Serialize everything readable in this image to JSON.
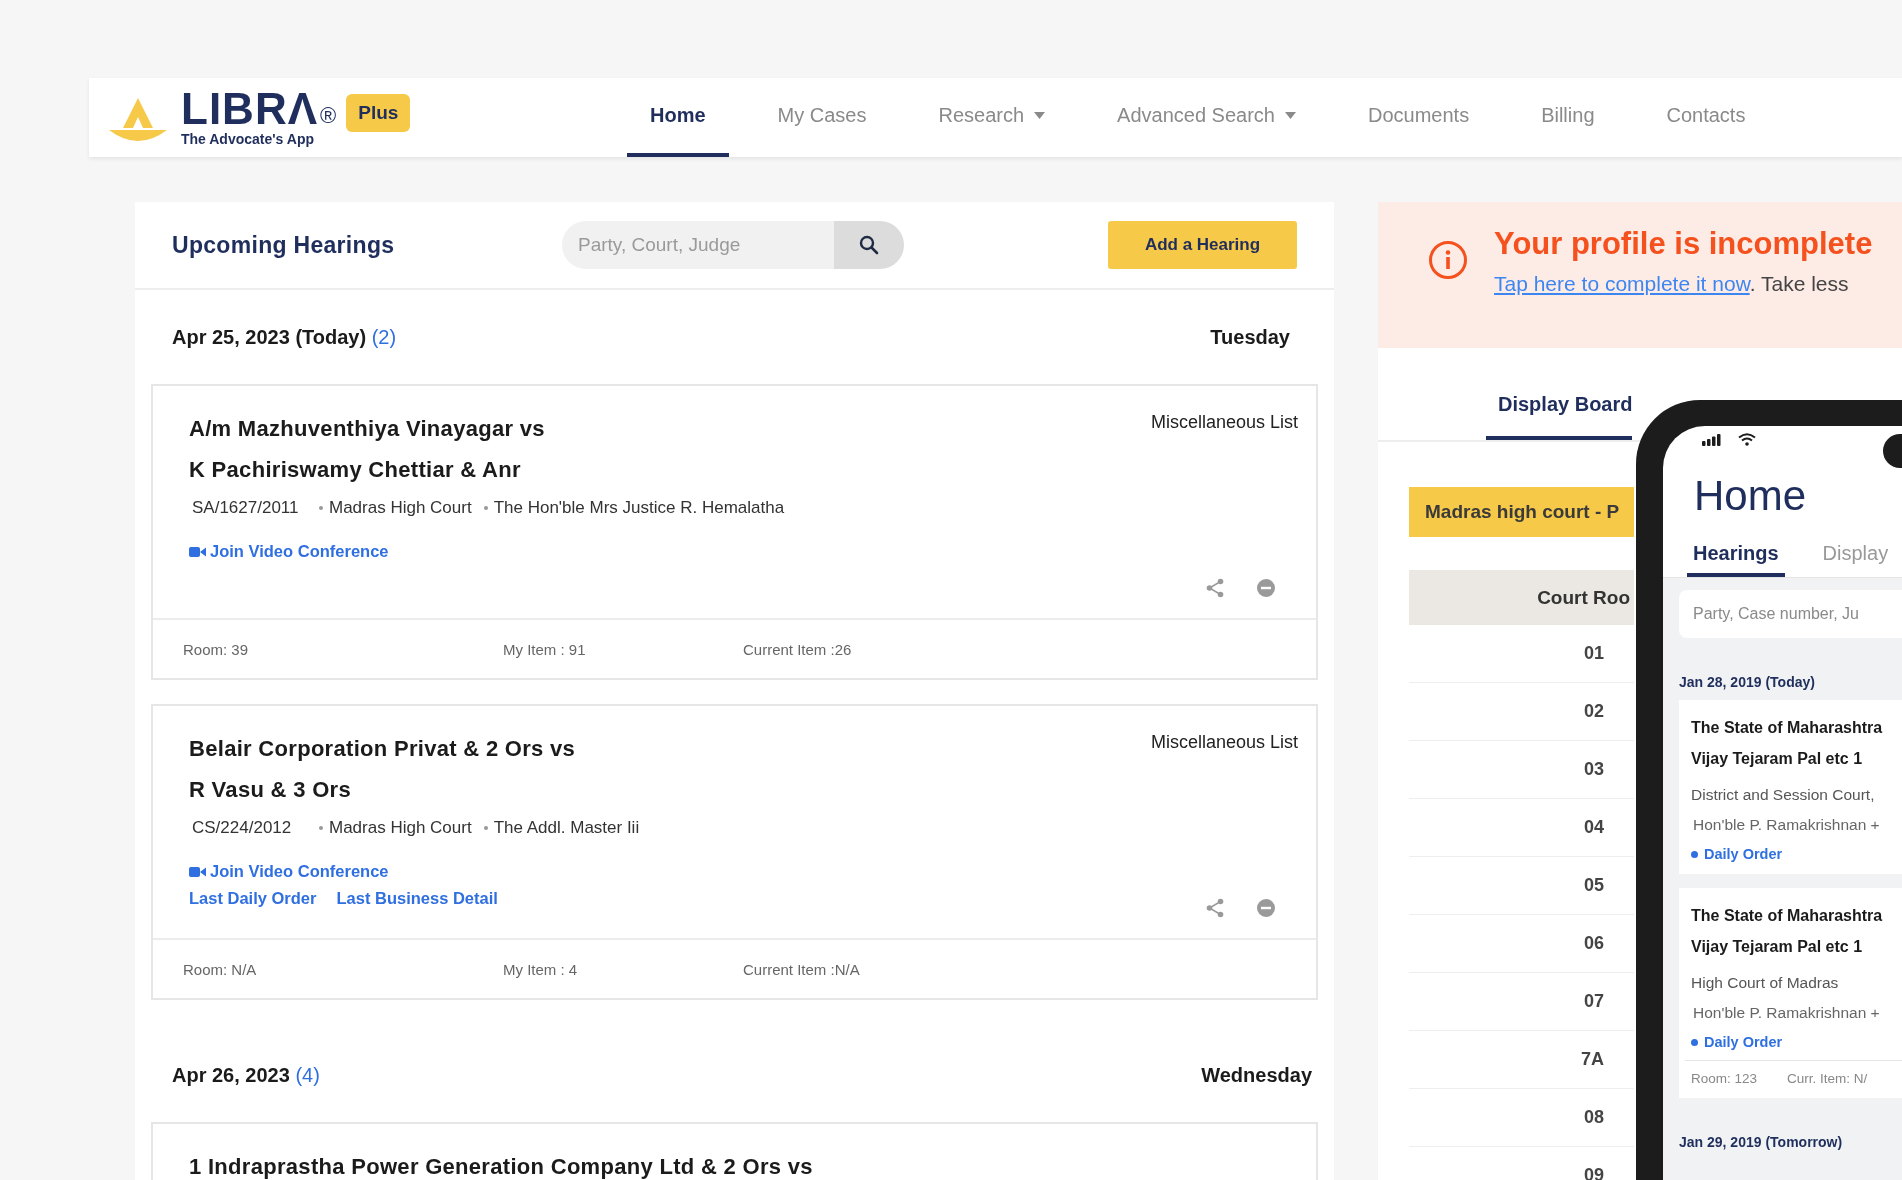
{
  "header": {
    "logo": {
      "name": "LIBRΛ",
      "registered": "®",
      "tagline": "The Advocate's App",
      "badge": "Plus"
    },
    "nav": [
      {
        "label": "Home",
        "selected": true,
        "dropdown": false
      },
      {
        "label": "My Cases",
        "selected": false,
        "dropdown": false
      },
      {
        "label": "Research",
        "selected": false,
        "dropdown": true
      },
      {
        "label": "Advanced Search",
        "selected": false,
        "dropdown": true
      },
      {
        "label": "Documents",
        "selected": false,
        "dropdown": false
      },
      {
        "label": "Billing",
        "selected": false,
        "dropdown": false
      },
      {
        "label": "Contacts",
        "selected": false,
        "dropdown": false
      }
    ]
  },
  "hearings": {
    "title": "Upcoming Hearings",
    "search": {
      "placeholder": "Party, Court, Judge"
    },
    "add_button": "Add a Hearing",
    "days": [
      {
        "date": "Apr 25, 2023 (Today)",
        "count": "(2)",
        "weekday": "Tuesday",
        "cases": [
          {
            "title_lines": [
              "A/m Mazhuventhiya Vinayagar vs",
              "K Pachiriswamy Chettiar & Anr"
            ],
            "list": "Miscellaneous List",
            "case_number": "SA/1627/2011",
            "court": "Madras High Court",
            "judge": "The Hon'ble Mrs Justice R. Hemalatha",
            "links": [
              {
                "kind": "video",
                "label": "Join Video Conference"
              }
            ],
            "room": "Room: 39",
            "my_item": "My Item : 91",
            "current_item": "Current Item :26"
          },
          {
            "title_lines": [
              "Belair Corporation Privat & 2 Ors vs",
              "R Vasu & 3 Ors"
            ],
            "list": "Miscellaneous List",
            "case_number": "CS/224/2012",
            "court": "Madras High Court",
            "judge": "The Addl. Master Iii",
            "links": [
              {
                "kind": "video",
                "label": "Join Video Conference"
              },
              {
                "kind": "plain",
                "label": "Last Daily Order"
              },
              {
                "kind": "plain",
                "label": "Last Business Detail"
              }
            ],
            "room": "Room: N/A",
            "my_item": "My Item : 4",
            "current_item": "Current Item :N/A"
          }
        ]
      },
      {
        "date": "Apr 26, 2023",
        "count": "(4)",
        "weekday": "Wednesday",
        "cases": [
          {
            "title_lines": [
              "1 Indraprastha Power Generation Company Ltd & 2 Ors vs"
            ]
          }
        ]
      }
    ]
  },
  "profile": {
    "title": "Your profile is incomplete",
    "link": "Tap here to complete it now",
    "after": ". Take less"
  },
  "board": {
    "tabs": [
      {
        "label": "Display Board",
        "selected": true
      }
    ],
    "court_label": "Madras high court - P",
    "column": "Court Roo",
    "rooms": [
      "01",
      "02",
      "03",
      "04",
      "05",
      "06",
      "07",
      "7A",
      "08",
      "09"
    ]
  },
  "phone": {
    "title": "Home",
    "tabs": [
      {
        "label": "Hearings",
        "selected": true
      },
      {
        "label": "Display",
        "selected": false
      }
    ],
    "search": {
      "placeholder": "Party, Case number, Ju"
    },
    "days": [
      {
        "date": "Jan 28, 2019 (Today)",
        "cases": [
          {
            "title_lines": [
              "The State of Maharashtra",
              "Vijay Tejaram Pal etc 1"
            ],
            "court": "District and Session Court,",
            "judge": "Hon'ble P. Ramakrishnan +",
            "link": "Daily Order"
          },
          {
            "title_lines": [
              "The State of Maharashtra",
              "Vijay Tejaram Pal etc 1"
            ],
            "court": "High Court of Madras",
            "judge": "Hon'ble P. Ramakrishnan +",
            "link": "Daily Order",
            "room": "Room: 123",
            "current_item": "Curr. Item: N/"
          }
        ]
      },
      {
        "date": "Jan 29, 2019 (Tomorrow)"
      }
    ]
  }
}
